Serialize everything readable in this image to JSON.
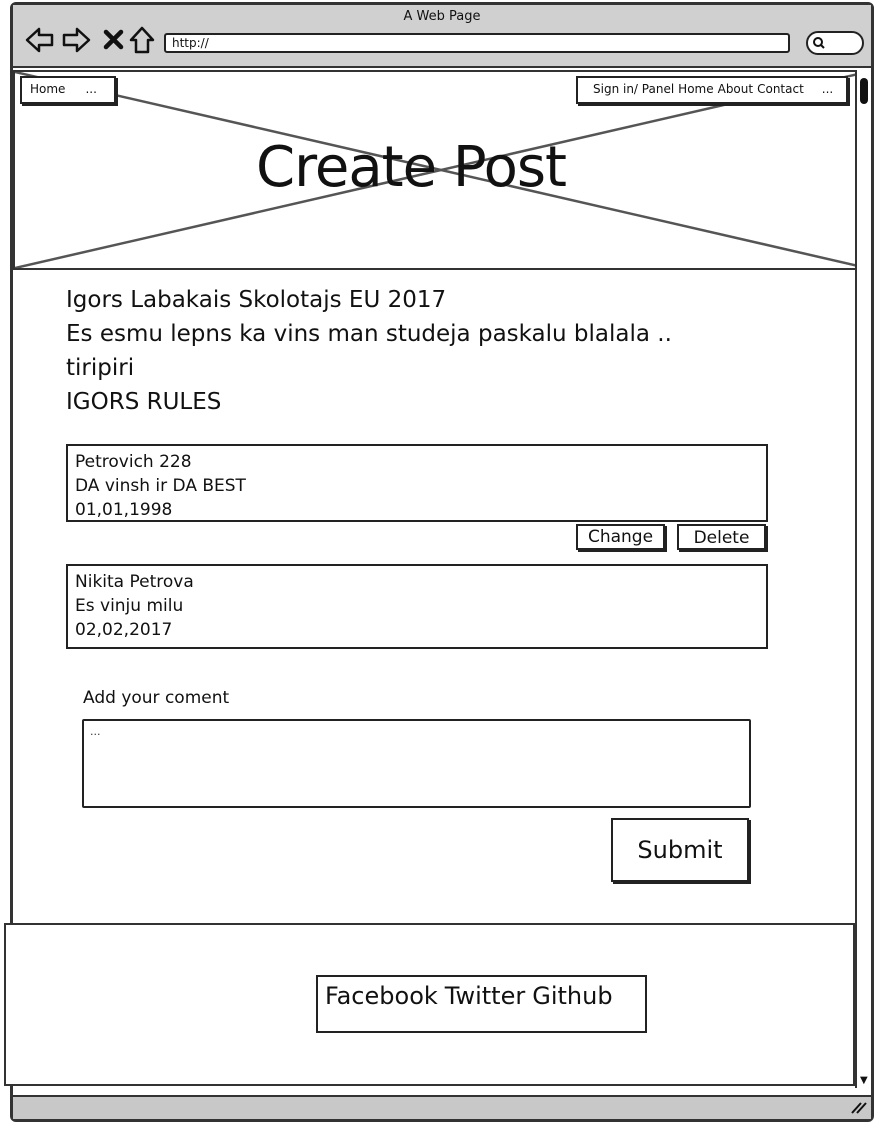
{
  "window": {
    "title": "A Web Page"
  },
  "browser": {
    "url": "http://"
  },
  "nav_left": {
    "home": "Home",
    "more": "..."
  },
  "nav_right": {
    "signin": "Sign in/ Panel",
    "home": "Home",
    "about": "About",
    "contact": "Contact",
    "more": "..."
  },
  "header": {
    "title": "Create Post"
  },
  "post": {
    "line1": "Igors Labakais Skolotajs EU 2017",
    "line2": "Es esmu lepns ka vins man studeja paskalu blalala ..",
    "line3": "tiripiri",
    "line4": "IGORS RULES"
  },
  "comments": [
    {
      "author": "Petrovich 228",
      "text": "DA vinsh ir DA BEST",
      "date": "01,01,1998"
    },
    {
      "author": "Nikita Petrova",
      "text": "Es vinju milu",
      "date": "02,02,2017"
    }
  ],
  "comment_actions": {
    "change": "Change",
    "delete": "Delete"
  },
  "form": {
    "label": "Add your coment",
    "placeholder": "...",
    "submit": "Submit"
  },
  "footer": {
    "facebook": "Facebook",
    "twitter": "Twitter",
    "github": "Github"
  }
}
